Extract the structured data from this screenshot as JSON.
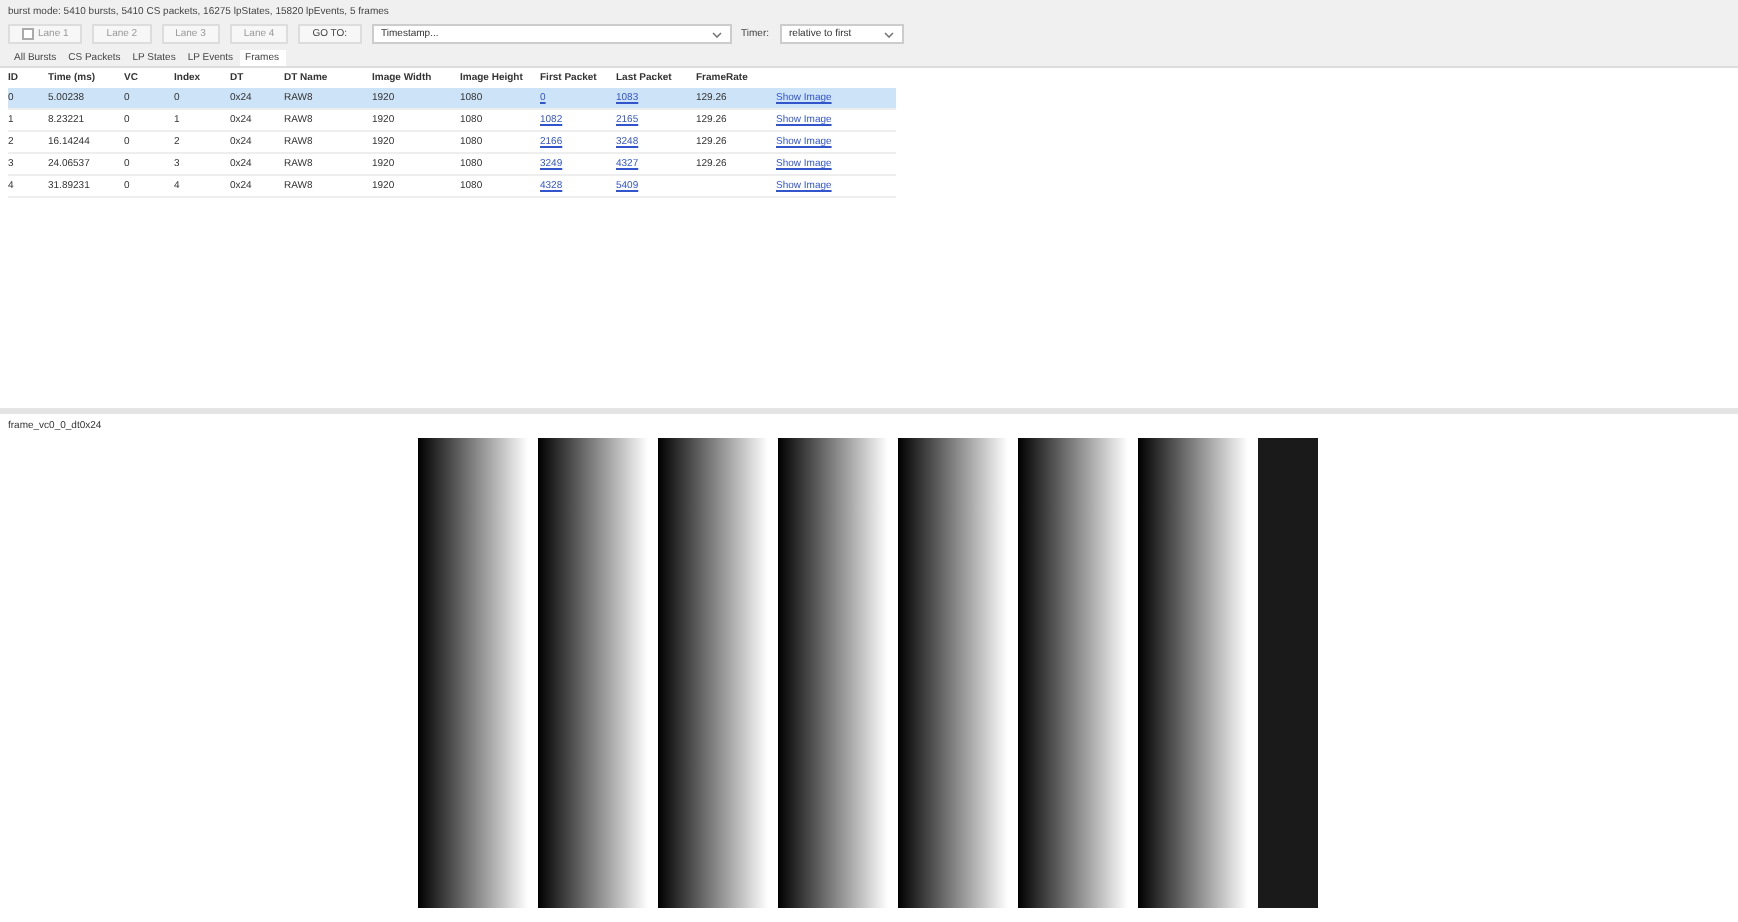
{
  "status": "burst mode: 5410 bursts, 5410 CS packets, 16275 lpStates, 15820 lpEvents, 5 frames",
  "lane_buttons": [
    {
      "label": "Lane 1",
      "checked": false
    },
    {
      "label": "Lane 2"
    },
    {
      "label": "Lane 3"
    },
    {
      "label": "Lane 4"
    }
  ],
  "goto": {
    "button": "GO TO:",
    "value": "Timestamp..."
  },
  "timer": {
    "label": "Timer:",
    "value": "relative to first"
  },
  "tabs": [
    {
      "label": "All Bursts",
      "selected": false
    },
    {
      "label": "CS Packets",
      "selected": false
    },
    {
      "label": "LP States",
      "selected": false
    },
    {
      "label": "LP Events",
      "selected": false
    },
    {
      "label": "Frames",
      "selected": true
    }
  ],
  "table": {
    "columns": [
      "ID",
      "Time (ms)",
      "VC",
      "Index",
      "DT",
      "DT Name",
      "Image Width",
      "Image Height",
      "First Packet",
      "Last Packet",
      "FrameRate"
    ],
    "rows": [
      {
        "selected": true,
        "cells": [
          "0",
          "5.00238",
          "0",
          "0",
          "0x24",
          "RAW8",
          "1920",
          "1080",
          "0",
          "1083",
          "129.26"
        ],
        "link": "Show Image"
      },
      {
        "selected": false,
        "cells": [
          "1",
          "8.23221",
          "0",
          "1",
          "0x24",
          "RAW8",
          "1920",
          "1080",
          "1082",
          "2165",
          "129.26"
        ],
        "link": "Show Image"
      },
      {
        "selected": false,
        "cells": [
          "2",
          "16.14244",
          "0",
          "2",
          "0x24",
          "RAW8",
          "1920",
          "1080",
          "2166",
          "3248",
          "129.26"
        ],
        "link": "Show Image"
      },
      {
        "selected": false,
        "cells": [
          "3",
          "24.06537",
          "0",
          "3",
          "0x24",
          "RAW8",
          "1920",
          "1080",
          "3249",
          "4327",
          "129.26"
        ],
        "link": "Show Image"
      },
      {
        "selected": false,
        "cells": [
          "4",
          "31.89231",
          "0",
          "4",
          "0x24",
          "RAW8",
          "1920",
          "1080",
          "4328",
          "5409",
          ""
        ],
        "link": "Show Image"
      }
    ]
  },
  "image_panel": {
    "title": "frame_vc0_0_dt0x24",
    "kind": "picture"
  }
}
